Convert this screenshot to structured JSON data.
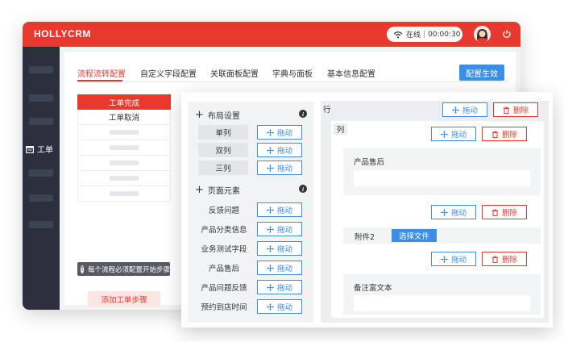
{
  "app": {
    "brand": "HOLLYCRM"
  },
  "status": {
    "state": "在线",
    "timer": "00:00:30"
  },
  "sidebar": {
    "active_label": "工单"
  },
  "tabs": [
    {
      "label": "流程流转配置",
      "active": true
    },
    {
      "label": "自定义字段配置",
      "active": false
    },
    {
      "label": "关联面板配置",
      "active": false
    },
    {
      "label": "字典与面板",
      "active": false
    },
    {
      "label": "基本信息配置",
      "active": false
    }
  ],
  "apply_label": "配置生效",
  "steps": {
    "items": [
      "工单完成",
      "工单取消"
    ],
    "tip": "每个流程必须配置开始步骤",
    "add_label": "添加工单步骤"
  },
  "designer": {
    "layout_section": "布局设置",
    "layout_items": [
      "单列",
      "双列",
      "三列"
    ],
    "element_section": "页面元素",
    "element_items": [
      "反馈问题",
      "产品分类信息",
      "业务测试字段",
      "产品售后",
      "产品问题反馈",
      "预约到店时间"
    ],
    "drag_label": "拖动",
    "delete_label": "删除",
    "row_tag": "行",
    "col_tag": "列",
    "field_after_sales": "产品售后",
    "attachment_label": "附件2",
    "choose_file_label": "选择文件",
    "field_remark": "备注富文本"
  },
  "colors": {
    "brand_red": "#e8392e",
    "primary_blue": "#3a8ee6",
    "sidebar_dark": "#2b2f3e"
  }
}
